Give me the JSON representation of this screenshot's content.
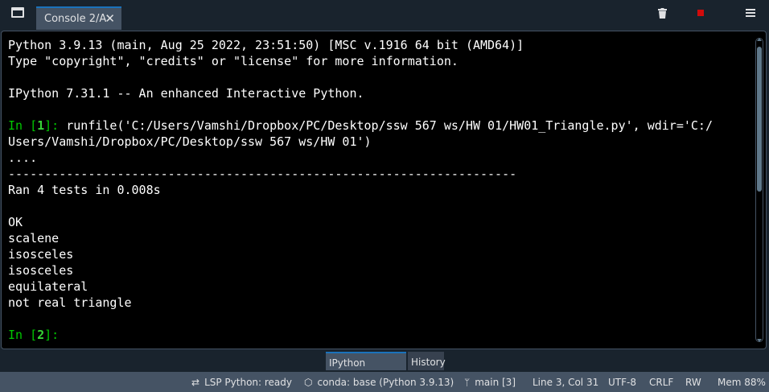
{
  "window": {
    "tab_label": "Console 2/A",
    "close_glyph": "✕"
  },
  "toolbar": {
    "icons": [
      "window-icon",
      "trash-icon",
      "stop-icon",
      "menu-icon"
    ],
    "stop_color": "#d10b0b"
  },
  "console": {
    "lines": {
      "l1": "Python 3.9.13 (main, Aug 25 2022, 23:51:50) [MSC v.1916 64 bit (AMD64)]",
      "l2": "Type \"copyright\", \"credits\" or \"license\" for more information.",
      "l3": "IPython 7.31.1 -- An enhanced Interactive Python.",
      "cmd1": "runfile('C:/Users/Vamshi/Dropbox/PC/Desktop/ssw 567 ws/HW 01/HW01_Triangle.py', wdir='C:/",
      "cmd1b": "Users/Vamshi/Dropbox/PC/Desktop/ssw 567 ws/HW 01')",
      "dots": "....",
      "dashes": "----------------------------------------------------------------------",
      "ran": "Ran 4 tests in 0.008s",
      "ok": "OK",
      "r1": "scalene",
      "r2": "isosceles",
      "r3": "isosceles",
      "r4": "equilateral",
      "r5": "not real triangle"
    },
    "prompt1": {
      "pre": "In [",
      "num": "1",
      "post": "]: "
    },
    "prompt2": {
      "pre": "In [",
      "num": "2",
      "post": "]:"
    }
  },
  "bottom_tabs": [
    "IPython Console",
    "History"
  ],
  "status": {
    "lsp": "LSP Python: ready",
    "conda": "conda: base (Python 3.9.13)",
    "git": "main [3]",
    "position": "Line 3, Col 31",
    "encoding": "UTF-8",
    "eol": "CRLF",
    "mode": "RW",
    "memory": "Mem 88%"
  }
}
